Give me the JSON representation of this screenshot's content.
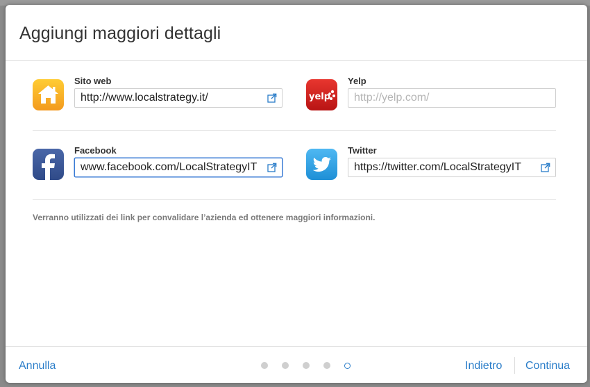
{
  "dialog": {
    "title": "Aggiungi maggiori dettagli",
    "info_text": "Verranno utilizzati dei link per convalidare l’azienda ed ottenere maggiori informazioni."
  },
  "fields": {
    "website": {
      "label": "Sito web",
      "value": "http://www.localstrategy.it/",
      "placeholder": "",
      "icon": "home-icon",
      "color": "#f5a623"
    },
    "yelp": {
      "label": "Yelp",
      "value": "",
      "placeholder": "http://yelp.com/",
      "icon": "yelp-icon",
      "color": "#d32323"
    },
    "facebook": {
      "label": "Facebook",
      "value": "www.facebook.com/LocalStrategyIT",
      "placeholder": "",
      "icon": "facebook-icon",
      "color": "#3b5998"
    },
    "twitter": {
      "label": "Twitter",
      "value": "https://twitter.com/LocalStrategyIT",
      "placeholder": "",
      "icon": "twitter-icon",
      "color": "#2aa3ef"
    }
  },
  "footer": {
    "cancel_label": "Annulla",
    "back_label": "Indietro",
    "continue_label": "Continua",
    "pager": {
      "total": 5,
      "current": 5
    }
  },
  "colors": {
    "accent": "#2a7dc9",
    "focus": "#3a7bd5"
  }
}
